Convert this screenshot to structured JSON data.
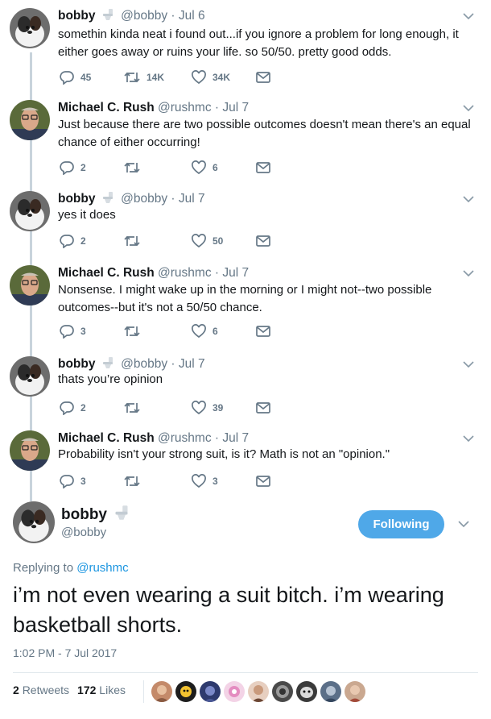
{
  "thread": [
    {
      "name": "bobby",
      "handle": "@bobby",
      "date": "Jul 6",
      "avatar": "dog-avatar",
      "verified_badge": "toilet-emoji",
      "text": "somethin kinda neat i found out...if you ignore a problem for long enough, it either goes away or ruins your life. so 50/50. pretty good odds.",
      "replies": "45",
      "retweets": "14K",
      "likes": "34K"
    },
    {
      "name": "Michael C. Rush",
      "handle": "@rushmc",
      "date": "Jul 7",
      "avatar": "man-glasses-avatar",
      "text": "Just because there are two possible outcomes doesn't mean there's an equal chance of either occurring!",
      "replies": "2",
      "retweets": "",
      "likes": "6"
    },
    {
      "name": "bobby",
      "handle": "@bobby",
      "date": "Jul 7",
      "avatar": "dog-avatar",
      "verified_badge": "toilet-emoji",
      "text": "yes it does",
      "replies": "2",
      "retweets": "",
      "likes": "50"
    },
    {
      "name": "Michael C. Rush",
      "handle": "@rushmc",
      "date": "Jul 7",
      "avatar": "man-glasses-avatar",
      "text": "Nonsense.  I might wake up in the morning or I might not--two possible outcomes--but it's not a 50/50 chance.",
      "replies": "3",
      "retweets": "",
      "likes": "6"
    },
    {
      "name": "bobby",
      "handle": "@bobby",
      "date": "Jul 7",
      "avatar": "dog-avatar",
      "verified_badge": "toilet-emoji",
      "text": "thats you’re opinion",
      "replies": "2",
      "retweets": "",
      "likes": "39"
    },
    {
      "name": "Michael C. Rush",
      "handle": "@rushmc",
      "date": "Jul 7",
      "avatar": "man-glasses-avatar",
      "text": "Probability isn't your strong suit, is it? Math is not an \"opinion.\"",
      "replies": "3",
      "retweets": "",
      "likes": "3"
    }
  ],
  "main_tweet": {
    "name": "bobby",
    "handle": "@bobby",
    "follow_label": "Following",
    "replying_prefix": "Replying to ",
    "replying_to": "@rushmc",
    "text": "i’m not even wearing a suit bitch. i’m wearing basketball shorts.",
    "timestamp": "1:02 PM - 7 Jul 2017",
    "retweets_count": "2",
    "retweets_label": "Retweets",
    "likes_count": "172",
    "likes_label": "Likes"
  },
  "colors": {
    "accent": "#4fa8e8",
    "link": "#1b95e0",
    "muted": "#657786",
    "thread_line": "#c8d3dc"
  },
  "icons": {
    "reply": "reply-icon",
    "retweet": "retweet-icon",
    "like": "heart-icon",
    "dm": "envelope-icon",
    "menu": "chevron-down-icon"
  }
}
